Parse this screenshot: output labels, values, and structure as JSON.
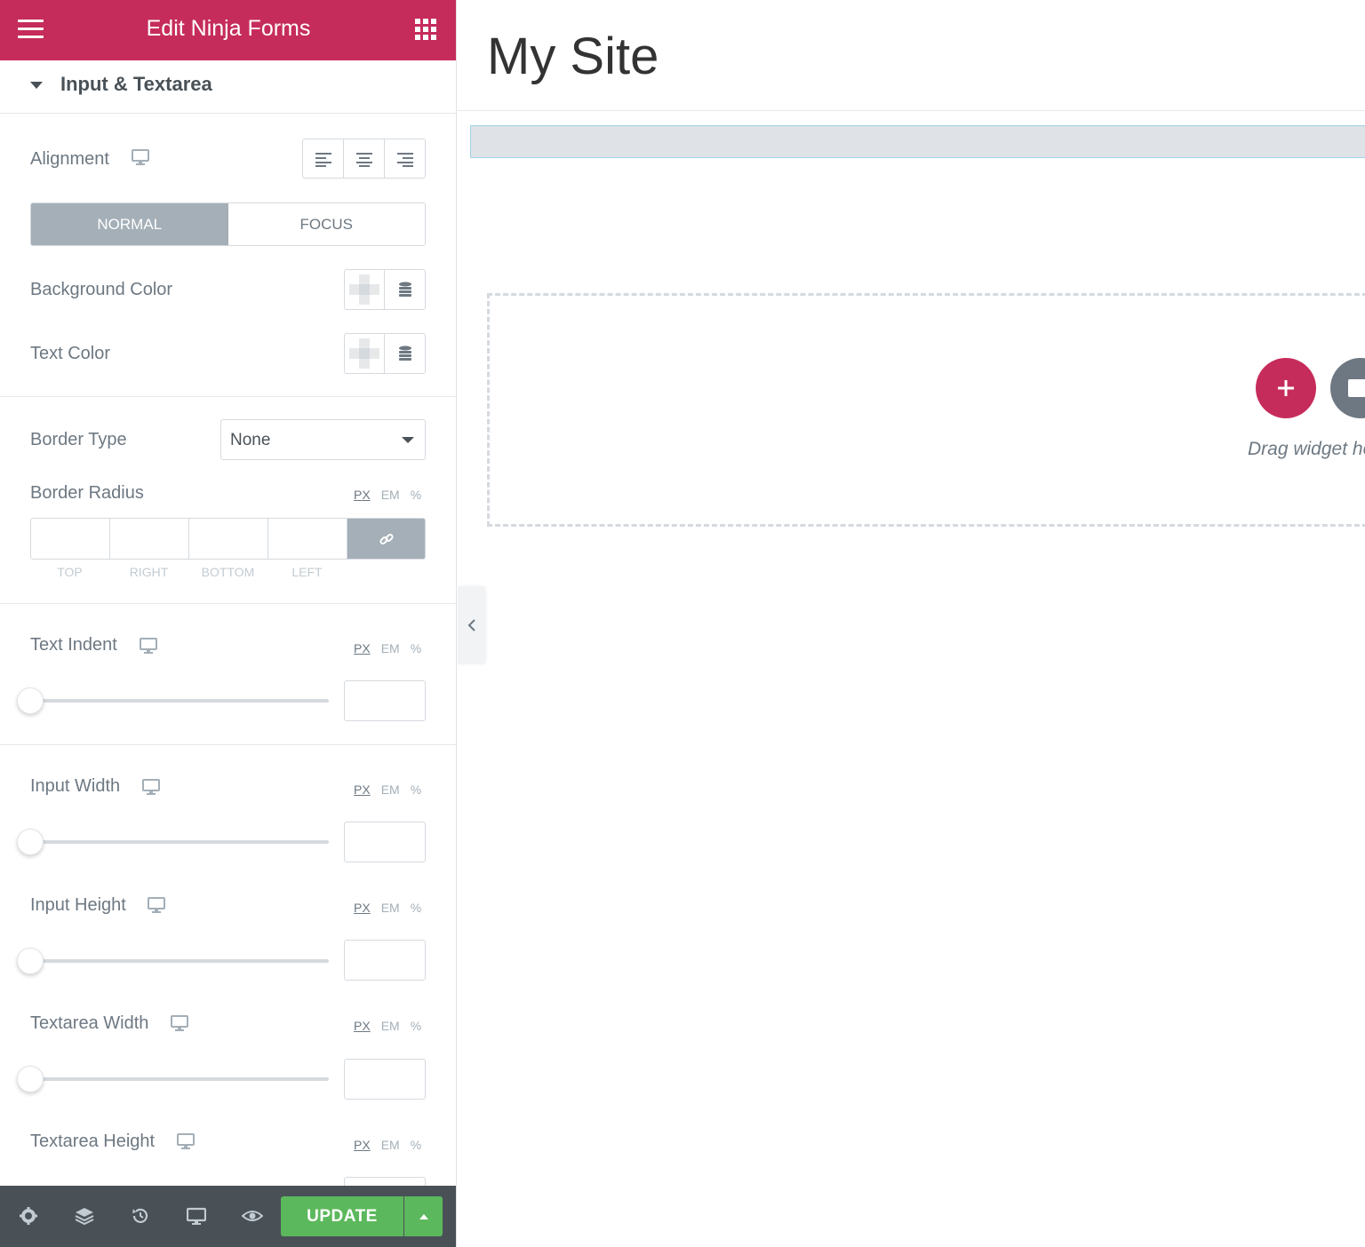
{
  "header": {
    "title": "Edit Ninja Forms"
  },
  "section": {
    "title": "Input & Textarea"
  },
  "controls": {
    "alignment": {
      "label": "Alignment"
    },
    "state_tabs": [
      {
        "label": "NORMAL",
        "active": true
      },
      {
        "label": "FOCUS",
        "active": false
      }
    ],
    "background_color": {
      "label": "Background Color"
    },
    "text_color": {
      "label": "Text Color"
    },
    "border_type": {
      "label": "Border Type",
      "value": "None"
    },
    "border_radius": {
      "label": "Border Radius",
      "dimension_labels": [
        "TOP",
        "RIGHT",
        "BOTTOM",
        "LEFT"
      ]
    },
    "text_indent": {
      "label": "Text Indent"
    },
    "input_width": {
      "label": "Input Width"
    },
    "input_height": {
      "label": "Input Height"
    },
    "textarea_width": {
      "label": "Textarea Width"
    },
    "textarea_height": {
      "label": "Textarea Height"
    },
    "units": [
      "PX",
      "EM",
      "%"
    ]
  },
  "footer": {
    "update_label": "UPDATE",
    "icons": [
      "gear-icon",
      "layers-icon",
      "history-icon",
      "responsive-icon",
      "preview-eye-icon"
    ]
  },
  "canvas": {
    "site_title": "My Site",
    "drag_text": "Drag widget here"
  },
  "colors": {
    "brand": "#c62c5b",
    "update_button": "#5cb85c",
    "footer_bg": "#495157",
    "active_tab": "#a4afb7"
  }
}
